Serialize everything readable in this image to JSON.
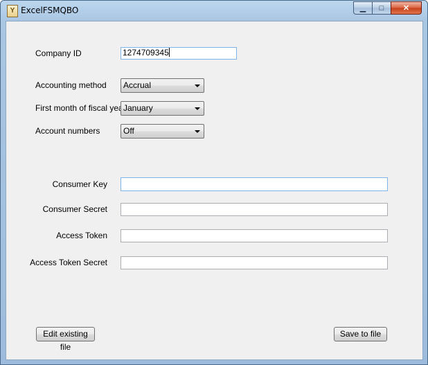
{
  "window": {
    "title": "ExcelFSMQBO",
    "app_icon_glyph": "Y",
    "minimize_glyph": "▁",
    "maximize_glyph": "□",
    "close_glyph": "✕"
  },
  "form": {
    "company_id_label": "Company ID",
    "company_id_value": "1274709345",
    "accounting_method_label": "Accounting method",
    "accounting_method_value": "Accrual",
    "fiscal_month_label": "First month of fiscal year",
    "fiscal_month_value": "January",
    "account_numbers_label": "Account numbers",
    "account_numbers_value": "Off",
    "consumer_key_label": "Consumer Key",
    "consumer_key_value": "",
    "consumer_secret_label": "Consumer Secret",
    "consumer_secret_value": "",
    "access_token_label": "Access Token",
    "access_token_value": "",
    "access_token_secret_label": "Access Token Secret",
    "access_token_secret_value": ""
  },
  "buttons": {
    "edit_existing": "Edit existing file",
    "save_to_file": "Save to file"
  },
  "colors": {
    "title_bar": "#a9c6e3",
    "client_bg": "#f0f0f0",
    "close_button": "#c7401a"
  }
}
